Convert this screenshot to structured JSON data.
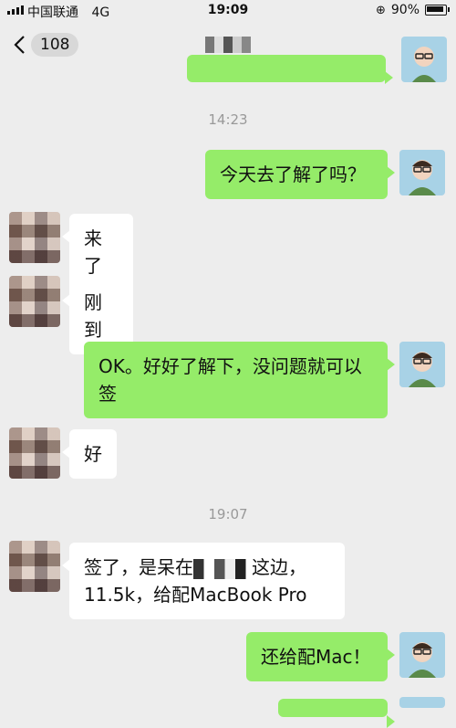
{
  "status": {
    "carrier": "中国联通",
    "network": "4G",
    "time": "19:09",
    "battery": "90%",
    "battery_level": 0.9
  },
  "nav": {
    "back_count": "108",
    "title": "",
    "colors": {
      "me_bubble": "#95ec69",
      "other_bubble": "#ffffff",
      "background": "#ededed"
    }
  },
  "chat": {
    "timestamps": [
      "14:23",
      "19:07"
    ],
    "messages": [
      {
        "from": "me",
        "text": "今天去了解了吗？"
      },
      {
        "from": "other",
        "text": "来了"
      },
      {
        "from": "other",
        "text": "刚到"
      },
      {
        "from": "me",
        "line1": "OK。好好了解下，没问题就可以",
        "line2": "签"
      },
      {
        "from": "other",
        "text": "好"
      },
      {
        "from": "other",
        "line1a": "签了，是呆在",
        "line1b": "这边，",
        "line2": "11.5k，给配MacBook Pro"
      },
      {
        "from": "me",
        "text": "还给配Mac！"
      }
    ]
  }
}
